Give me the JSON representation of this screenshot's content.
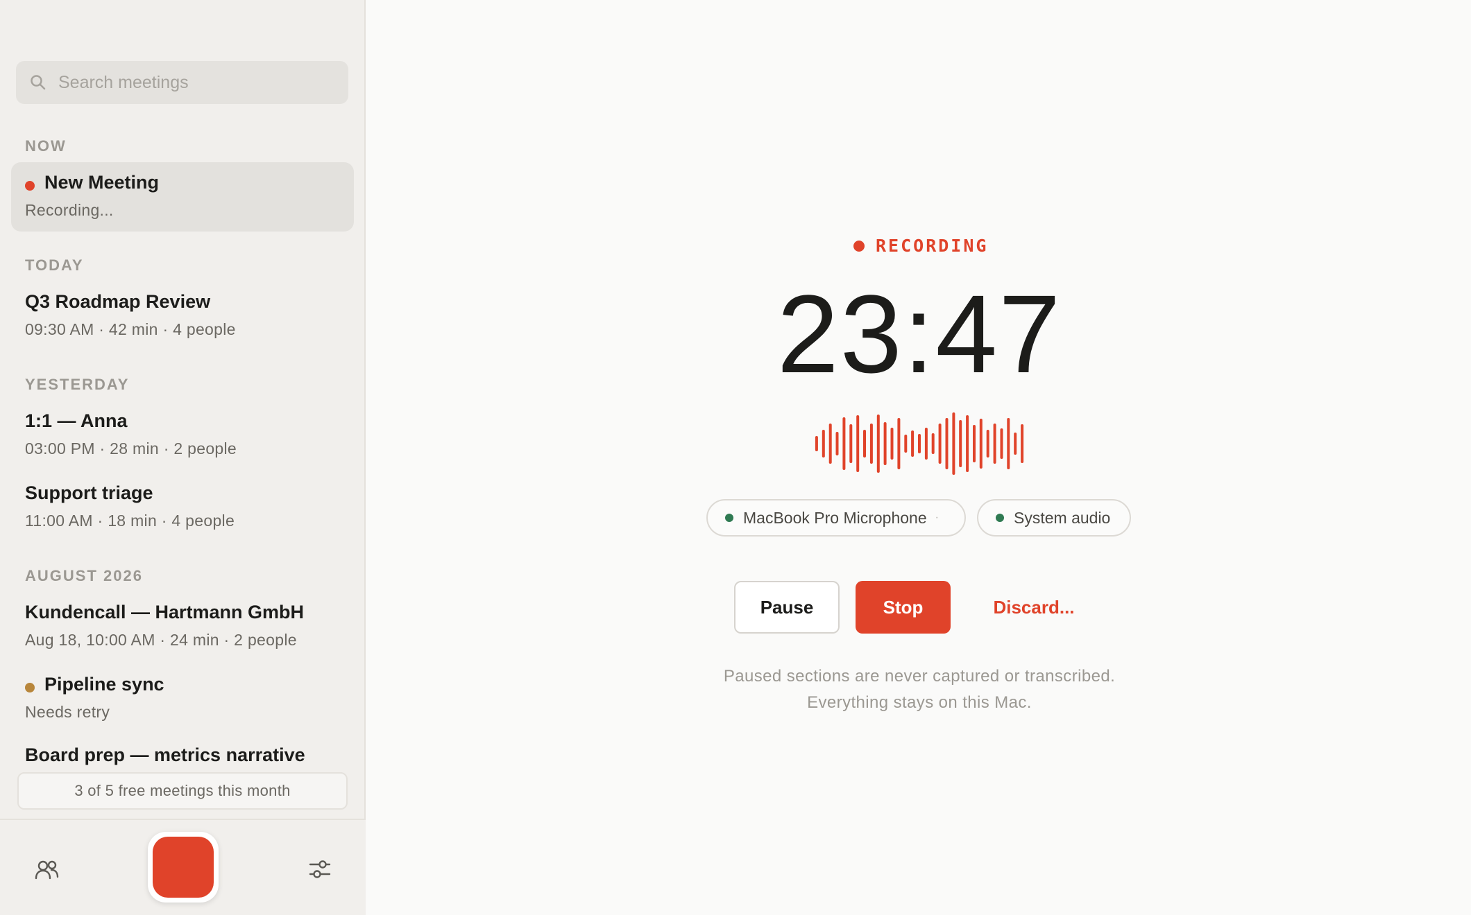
{
  "sidebar": {
    "search_placeholder": "Search meetings",
    "sections": {
      "now": "NOW",
      "today": "TODAY",
      "yesterday": "YESTERDAY",
      "august": "AUGUST 2026"
    },
    "meetings": [
      {
        "title": "New Meeting",
        "sub": "Recording...",
        "status": "recording",
        "status_color": "#e0432a"
      },
      {
        "title": "Q3 Roadmap Review",
        "sub": "09:30 AM · 42 min · 4 people"
      },
      {
        "title": "1:1 — Anna",
        "sub": "03:00 PM · 28 min · 2 people"
      },
      {
        "title": "Support triage",
        "sub": "11:00 AM · 18 min · 4 people"
      },
      {
        "title": "Kundencall — Hartmann GmbH",
        "sub": "Aug 18, 10:00 AM · 24 min · 2 people"
      },
      {
        "title": "Pipeline sync",
        "sub": "Needs retry",
        "status": "needs-retry",
        "status_color": "#b8863b"
      },
      {
        "title": "Board prep — metrics narrative",
        "sub": ""
      }
    ],
    "quota": "3 of 5 free meetings this month",
    "bottom_icons": [
      "people-icon",
      "record-button",
      "sliders-icon"
    ]
  },
  "main": {
    "status_label": "RECORDING",
    "timer": "23:47",
    "sources": [
      {
        "label": "MacBook Pro Microphone",
        "separator": "·"
      },
      {
        "label": "System audio"
      }
    ],
    "buttons": {
      "pause": "Pause",
      "stop": "Stop",
      "discard": "Discard..."
    },
    "note_line1": "Paused sections are never captured or transcribed.",
    "note_line2": "Everything stays on this Mac."
  },
  "colors": {
    "accent": "#e0432a",
    "source_active": "#2f7a52",
    "retry": "#b8863b"
  }
}
